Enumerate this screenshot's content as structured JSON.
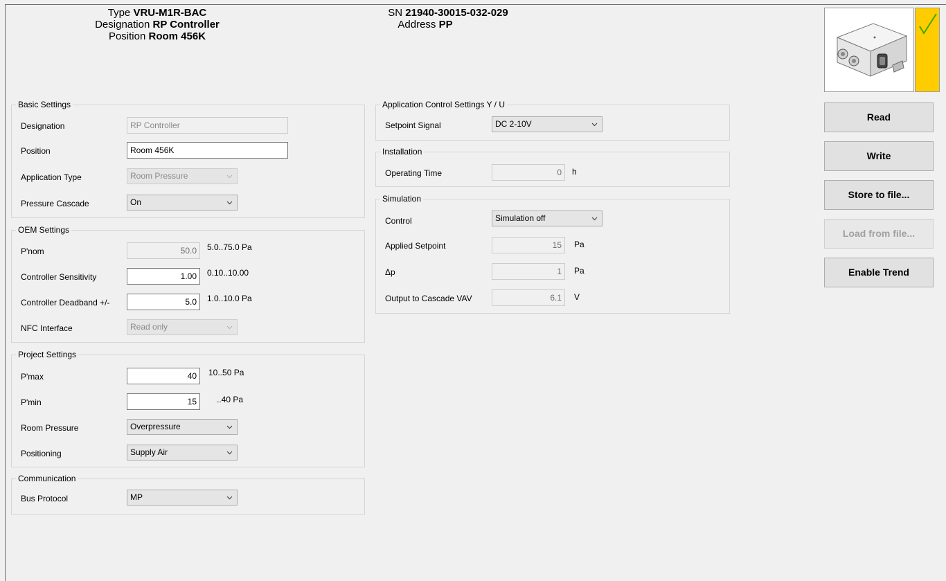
{
  "header": {
    "type_label": "Type",
    "type_value": "VRU-M1R-BAC",
    "designation_label": "Designation",
    "designation_value": "RP Controller",
    "position_label": "Position",
    "position_value": "Room 456K",
    "sn_label": "SN",
    "sn_value": "21940-30015-032-029",
    "address_label": "Address",
    "address_value": "PP"
  },
  "basic_settings": {
    "title": "Basic Settings",
    "designation_label": "Designation",
    "designation_value": "RP Controller",
    "position_label": "Position",
    "position_value": "Room 456K",
    "application_type_label": "Application Type",
    "application_type_value": "Room Pressure",
    "pressure_cascade_label": "Pressure Cascade",
    "pressure_cascade_value": "On"
  },
  "oem_settings": {
    "title": "OEM Settings",
    "pnom_label": "P'nom",
    "pnom_value": "50.0",
    "pnom_range": "5.0..75.0 Pa",
    "sensitivity_label": "Controller Sensitivity",
    "sensitivity_value": "1.00",
    "sensitivity_range": "0.10..10.00",
    "deadband_label": "Controller Deadband +/-",
    "deadband_value": "5.0",
    "deadband_range": "1.0..10.0 Pa",
    "nfc_label": "NFC Interface",
    "nfc_value": "Read only"
  },
  "project_settings": {
    "title": "Project Settings",
    "pmax_label": "P'max",
    "pmax_value": "40",
    "pmax_range": "10..50 Pa",
    "pmin_label": "P'min",
    "pmin_value": "15",
    "pmin_range": "..40 Pa",
    "room_pressure_label": "Room Pressure",
    "room_pressure_value": "Overpressure",
    "positioning_label": "Positioning",
    "positioning_value": "Supply Air"
  },
  "communication": {
    "title": "Communication",
    "bus_protocol_label": "Bus Protocol",
    "bus_protocol_value": "MP"
  },
  "app_control": {
    "title": "Application Control Settings Y / U",
    "setpoint_signal_label": "Setpoint Signal",
    "setpoint_signal_value": "DC 2-10V"
  },
  "installation": {
    "title": "Installation",
    "operating_time_label": "Operating Time",
    "operating_time_value": "0",
    "operating_time_unit": "h"
  },
  "simulation": {
    "title": "Simulation",
    "control_label": "Control",
    "control_value": "Simulation off",
    "applied_setpoint_label": "Applied Setpoint",
    "applied_setpoint_value": "15",
    "applied_setpoint_unit": "Pa",
    "dp_label": "Δp",
    "dp_value": "1",
    "dp_unit": "Pa",
    "output_label": "Output to Cascade VAV",
    "output_value": "6.1",
    "output_unit": "V"
  },
  "actions": {
    "read": "Read",
    "write": "Write",
    "store": "Store to file...",
    "load": "Load from file...",
    "trend": "Enable Trend"
  },
  "colors": {
    "status_yellow": "#ffcc00",
    "check_green": "#3aa800"
  }
}
